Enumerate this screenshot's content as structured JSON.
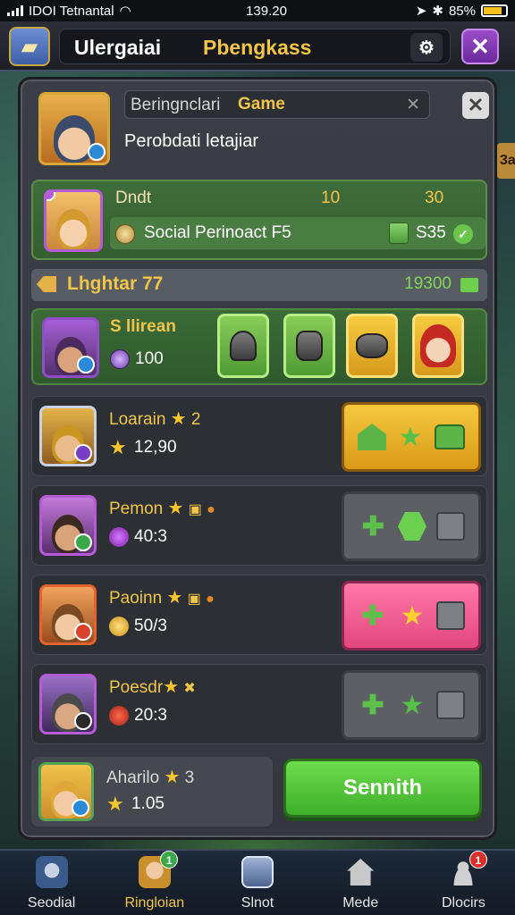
{
  "status_bar": {
    "carrier": "IDOI Tetnantal",
    "time": "139.20",
    "battery": "85%"
  },
  "header": {
    "title_primary": "Ulergaiai",
    "title_secondary": "Pbengkass",
    "settings_icon": "settings-icon",
    "close_icon": "close-icon"
  },
  "side_tag": "3a",
  "profile": {
    "search_text": "Beringnclari",
    "search_highlight": "Game",
    "subtitle": "Perobdati letajiar"
  },
  "info_card": {
    "name": "Dndt",
    "num1": "10",
    "num2": "30",
    "social_text": "Social Perinoact F5",
    "gift_value": "S35"
  },
  "lighter_bar": {
    "label": "Lhghtar 77",
    "value": "19300"
  },
  "hero": {
    "name": "S llirean",
    "power": "100"
  },
  "rows": [
    {
      "name": "Loarain",
      "rank": "2",
      "stat": "12,90",
      "action_style": "gold"
    },
    {
      "name": "Pemon",
      "rank": "",
      "stat": "40:3",
      "action_style": "gray"
    },
    {
      "name": "Paoinn",
      "rank": "",
      "stat": "50/3",
      "action_style": "pink"
    },
    {
      "name": "Poesdr",
      "rank": "",
      "stat": "20:3",
      "action_style": "gray"
    }
  ],
  "last_row": {
    "name": "Aharilo",
    "rank": "3",
    "stat": "1.05"
  },
  "send_button": "Sennith",
  "nav": [
    {
      "label": "Seodial",
      "icon": "hero-icon",
      "active": false
    },
    {
      "label": "Ringloian",
      "icon": "character-icon",
      "active": true,
      "badge": "1"
    },
    {
      "label": "Slnot",
      "icon": "shop-icon",
      "active": false
    },
    {
      "label": "Mede",
      "icon": "home-icon",
      "active": false
    },
    {
      "label": "Dlocirs",
      "icon": "profile-icon",
      "active": false,
      "badge": "1"
    }
  ],
  "colors": {
    "accent_gold": "#f2c54a",
    "accent_green": "#5cc04a",
    "accent_pink": "#e2467f",
    "accent_purple": "#9b4cc9"
  }
}
